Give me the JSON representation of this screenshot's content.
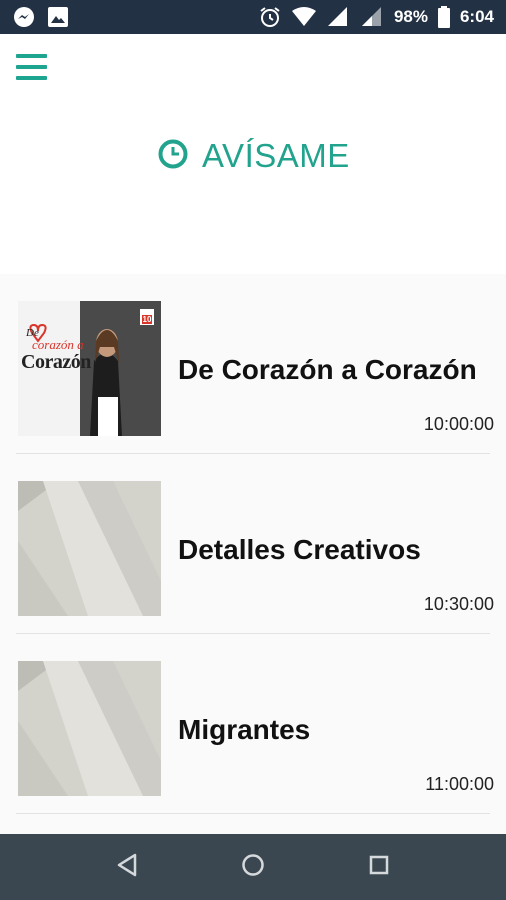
{
  "status_bar": {
    "battery": "98%",
    "time": "6:04",
    "icons": [
      "messenger-icon",
      "image-icon",
      "alarm-icon",
      "wifi-icon",
      "signal-icon",
      "signal-icon",
      "battery-icon"
    ]
  },
  "header": {
    "title": "AVÍSAME",
    "icons": [
      "menu-icon",
      "clock-icon"
    ]
  },
  "programs": [
    {
      "title": "De Corazón a Corazón",
      "time": "10:00:00",
      "thumbnail": "de-corazon-a-corazon"
    },
    {
      "title": "Detalles Creativos",
      "time": "10:30:00",
      "thumbnail": "placeholder"
    },
    {
      "title": "Migrantes",
      "time": "11:00:00",
      "thumbnail": "placeholder"
    }
  ],
  "thumbnail_logo": {
    "line1": "De",
    "line2": "corazón a",
    "line3": "Corazón",
    "channel": "10"
  },
  "navigation_bar": {
    "icons": [
      "back-icon",
      "home-icon",
      "recents-icon"
    ]
  },
  "colors": {
    "accent": "#22a38d",
    "status_bar": "#223144",
    "nav_bar": "#3b4750"
  }
}
